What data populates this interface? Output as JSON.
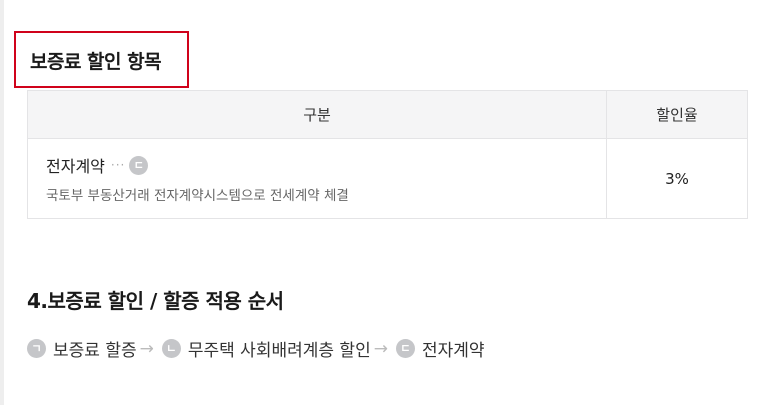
{
  "section_title": "보증료 할인 항목",
  "table": {
    "headers": [
      "구분",
      "할인율"
    ],
    "rows": [
      {
        "name": "전자계약",
        "dots": "···",
        "badge": "ㄷ",
        "description": "국토부 부동산거래 전자계약시스템으로 전세계약 체결",
        "rate": "3%"
      }
    ]
  },
  "order_title": "4.보증료 할인 / 할증 적용 순서",
  "order_steps": [
    {
      "badge": "ㄱ",
      "label": "보증료 할증"
    },
    {
      "badge": "ㄴ",
      "label": "무주택 사회배려계층 할인"
    },
    {
      "badge": "ㄷ",
      "label": "전자계약"
    }
  ],
  "arrow": "→",
  "colors": {
    "highlight_border": "#d0021b",
    "header_bg": "#f5f5f6",
    "badge_bg": "#c5c6c9"
  }
}
